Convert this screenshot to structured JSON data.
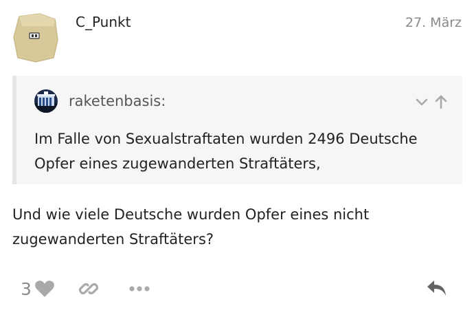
{
  "post": {
    "username": "C_Punkt",
    "date": "27. März",
    "quote": {
      "author": "raketenbasis:",
      "text": "Im Falle von Sexualstraftaten wurden 2496 Deutsche Opfer eines zugewanderten Straftäters,"
    },
    "body": "Und wie viele Deutsche wurden Opfer eines nicht zugewanderten Straftäters?",
    "like_count": "3"
  },
  "icons": {
    "avatar": "avatar-image",
    "quote_avatar": "quote-avatar-image",
    "expand": "chevron-down-icon",
    "jump": "arrow-up-icon",
    "like": "heart-icon",
    "link": "link-icon",
    "more": "ellipsis-icon",
    "reply": "reply-icon"
  },
  "colors": {
    "muted": "#8a8a8a",
    "icon": "#a9a9a9",
    "quote_bg": "#f6f6f6",
    "quote_border": "#e6e6e6"
  }
}
